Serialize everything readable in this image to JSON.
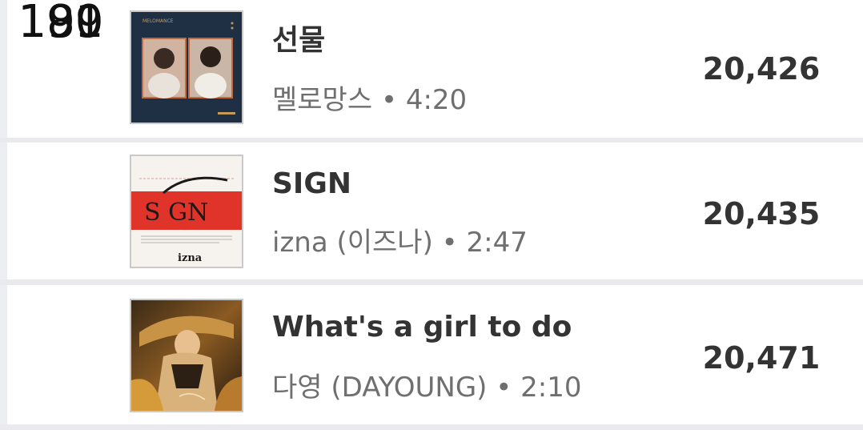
{
  "chart_rows": [
    {
      "rank": "189",
      "title": "선물",
      "artist": "멜로망스",
      "separator": "•",
      "duration": "4:20",
      "count": "20,426",
      "cover_icon": "melomance-album-cover",
      "cover_text": "MELOMANCE"
    },
    {
      "rank": "190",
      "title": "SIGN",
      "artist": "izna (이즈나)",
      "separator": "•",
      "duration": "2:47",
      "count": "20,435",
      "cover_icon": "izna-sign-album-cover",
      "cover_text": "S GN",
      "cover_logo": "izna"
    },
    {
      "rank": "191",
      "title": "What's a girl to do",
      "artist": "다영 (DAYOUNG)",
      "separator": "•",
      "duration": "2:10",
      "count": "20,471",
      "cover_icon": "dayoung-album-cover"
    }
  ]
}
